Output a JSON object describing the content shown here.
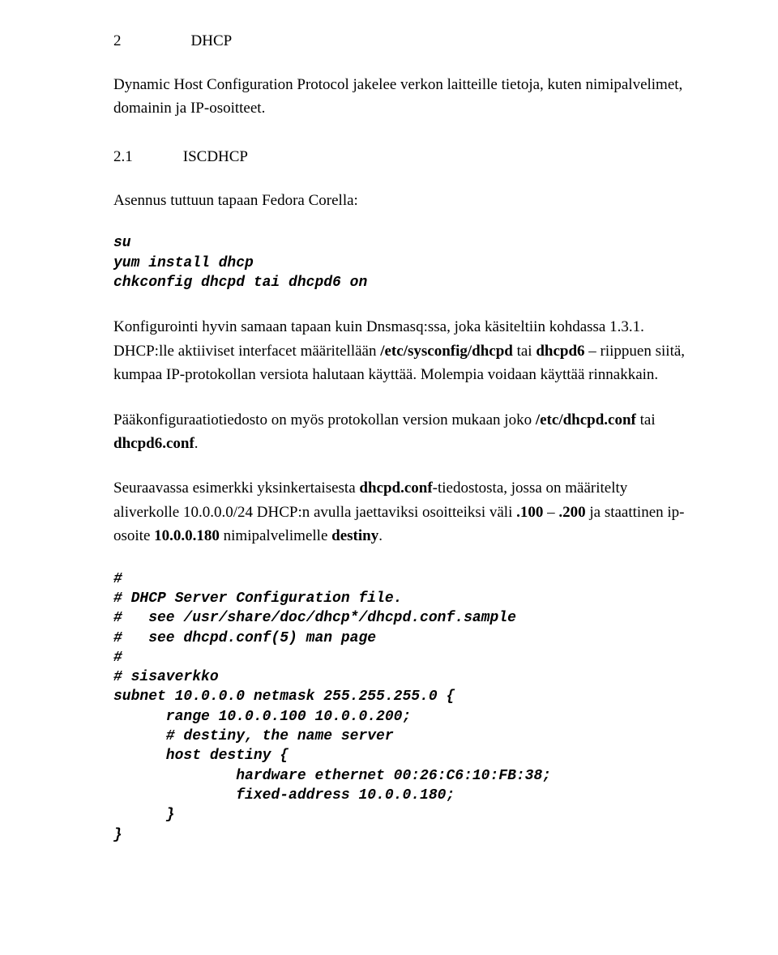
{
  "section": {
    "num": "2",
    "title": "DHCP"
  },
  "intro": "Dynamic Host Configuration Protocol jakelee verkon laitteille tietoja, kuten nimipalvelimet, domainin ja IP-osoitteet.",
  "subsection": {
    "num": "2.1",
    "title": "ISCDHCP"
  },
  "install_label": "Asennus tuttuun tapaan Fedora Corella:",
  "install_code": "su\nyum install dhcp\nchkconfig dhcpd tai dhcpd6 on",
  "para_konfig": {
    "pre": "Konfigurointi hyvin samaan tapaan kuin Dnsmasq:ssa, joka käsiteltiin kohdassa 1.3.1. DHCP:lle aktiiviset interfacet määritellään ",
    "b1": "/etc/sysconfig/dhcpd",
    "mid1": " tai ",
    "b2": "dhcpd6",
    "post": " – riippuen siitä, kumpaa IP-protokollan versiota halutaan käyttää. Molempia voidaan käyttää rinnakkain."
  },
  "para_paakonf": {
    "pre": "Pääkonfiguraatiotiedosto on myös protokollan version mukaan joko ",
    "b1": "/etc/dhcpd.conf",
    "mid1": " tai ",
    "b2": "dhcpd6.conf",
    "post": "."
  },
  "para_example": {
    "pre": "Seuraavassa esimerkki yksinkertaisesta ",
    "b1": "dhcpd.conf",
    "mid1": "-tiedostosta, jossa on määritelty aliverkolle 10.0.0.0/24 DHCP:n avulla jaettaviksi osoitteiksi väli ",
    "b2": ".100",
    "mid2": " – ",
    "b3": ".200",
    "mid3": " ja staattinen ip-osoite ",
    "b4": "10.0.0.180",
    "mid4": " nimipalvelimelle ",
    "b5": "destiny",
    "post": "."
  },
  "config_code": "#\n# DHCP Server Configuration file.\n#   see /usr/share/doc/dhcp*/dhcpd.conf.sample\n#   see dhcpd.conf(5) man page\n#\n# sisaverkko\nsubnet 10.0.0.0 netmask 255.255.255.0 {\n      range 10.0.0.100 10.0.0.200;\n      # destiny, the name server\n      host destiny {\n              hardware ethernet 00:26:C6:10:FB:38;\n              fixed-address 10.0.0.180;\n      }\n}"
}
